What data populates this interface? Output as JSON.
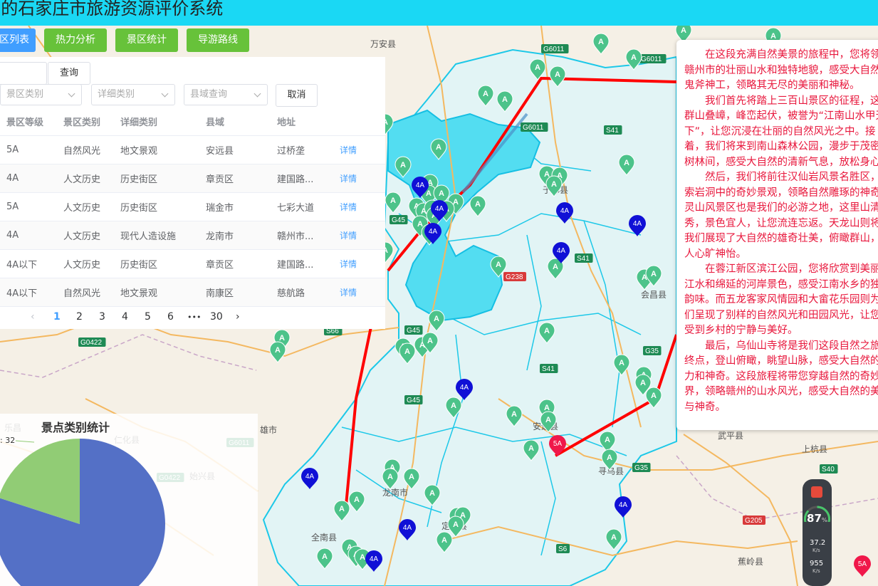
{
  "header": {
    "title": "S的石家庄市旅游资源评价系统"
  },
  "nav": {
    "list": "区列表",
    "heat": "热力分析",
    "stats": "景区统计",
    "route": "导游路线"
  },
  "search": {
    "query_button": "查询",
    "cancel_button": "取消",
    "filters": {
      "category": "景区类别",
      "detail": "详细类别",
      "county": "县域查询"
    }
  },
  "table": {
    "headers": {
      "level": "景区等级",
      "category": "景区类别",
      "detail": "详细类别",
      "county": "县域",
      "address": "地址"
    },
    "rows": [
      {
        "level": "5A",
        "category": "自然风光",
        "detail": "地文景观",
        "county": "安远县",
        "address": "过桥垄",
        "action": "详情"
      },
      {
        "level": "4A",
        "category": "人文历史",
        "detail": "历史街区",
        "county": "章贡区",
        "address": "建国路...",
        "action": "详情"
      },
      {
        "level": "5A",
        "category": "人文历史",
        "detail": "历史街区",
        "county": "瑞金市",
        "address": "七彩大道",
        "action": "详情"
      },
      {
        "level": "4A",
        "category": "人文历史",
        "detail": "现代人造设施",
        "county": "龙南市",
        "address": "赣州市...",
        "action": "详情"
      },
      {
        "level": "4A以下",
        "category": "人文历史",
        "detail": "历史街区",
        "county": "章贡区",
        "address": "建国路...",
        "action": "详情"
      },
      {
        "level": "4A以下",
        "category": "自然风光",
        "detail": "地文景观",
        "county": "南康区",
        "address": "慈航路",
        "action": "详情"
      }
    ]
  },
  "pagination": {
    "pages": [
      "1",
      "2",
      "3",
      "4",
      "5",
      "6"
    ],
    "ellipsis": "•••",
    "last": "30",
    "current": "1",
    "prev": "‹",
    "next": "›"
  },
  "chart_data": {
    "type": "pie",
    "title": "景点类别统计",
    "label_fragment": ": 32",
    "slices": [
      {
        "name": "",
        "value": 80,
        "color": "#5470c6"
      },
      {
        "name": "",
        "value": 20,
        "color": "#91cc75"
      }
    ]
  },
  "route_text": [
    "在这段充满自然美景的旅程中，您将领略赣州市的壮丽山水和独特地貌，感受大自然的鬼斧神工，领略其无尽的美丽和神秘。",
    "我们首先将踏上三百山景区的征程，这里群山叠嶂，峰峦起伏，被誉为“江南山水甲天下”，让您沉浸在壮丽的自然风光之中。接着，我们将来到南山森林公园，漫步于茂密的树林间，感受大自然的清新气息，放松身心。",
    "然后，我们将前往汉仙岩风景名胜区，探索岩洞中的奇妙景观，领略自然雕琢的神奇。灵山风景区也是我们的必游之地，这里山清水秀，景色宜人，让您流连忘返。天龙山则将为我们展现了大自然的雄奇壮美，俯瞰群山，令人心旷神怡。",
    "在蓉江新区滨江公园，您将欣赏到美丽的江水和绵延的河岸景色，感受江南水乡的独特韵味。而五龙客家风情园和大畲花乐园则为我们呈现了别样的自然风光和田园风光，让您感受到乡村的宁静与美好。",
    "最后，乌仙山寺将是我们这段自然之旅的终点，登山俯瞰，眺望山脉，感受大自然的魅力和神奇。这段旅程将带您穿越自然的奇妙世界，领略赣州的山水风光，感受大自然的美丽与神奇。"
  ],
  "map": {
    "place_labels": [
      "万安县",
      "于都县",
      "会昌县",
      "安远县",
      "龙南市",
      "全南县",
      "寻乌县",
      "武平县",
      "上杭县",
      "蕉岭县",
      "雄市",
      "始兴县",
      "乐昌",
      "仁化县",
      "定南县"
    ],
    "road_labels": [
      "G6011",
      "G6011",
      "G6011",
      "S41",
      "S41",
      "S41",
      "G45",
      "G45",
      "G45",
      "G238",
      "G35",
      "G35",
      "S66",
      "G0422",
      "S6",
      "S40",
      "G205",
      "G0422",
      "G6011"
    ],
    "badges": [
      "4A",
      "4A",
      "4A",
      "4A",
      "4A",
      "4A",
      "4A",
      "4A",
      "4A",
      "4A",
      "4A",
      "5A"
    ]
  },
  "widget": {
    "score": "87",
    "score_unit": "%",
    "up_speed": "37.2",
    "down_speed": "955",
    "unit": "K/s"
  },
  "marker_letter": "A"
}
